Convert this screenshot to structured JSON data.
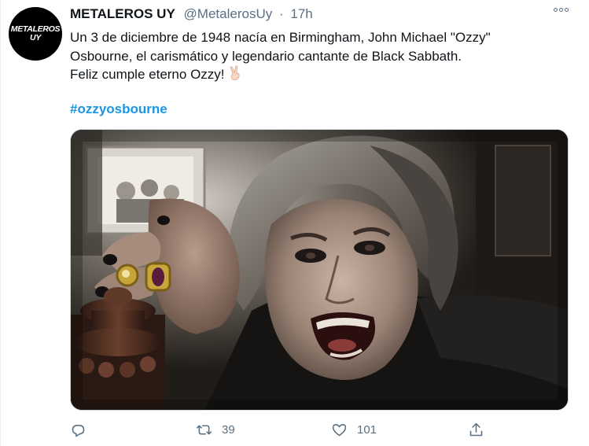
{
  "account": {
    "avatar_line1": "METALEROS",
    "avatar_line2": "UY",
    "display_name": "METALEROS UY",
    "handle": "@MetalerosUy",
    "separator": "·",
    "time": "17h"
  },
  "tweet": {
    "text_line1": "Un 3 de diciembre de 1948 nacía en Birmingham, John Michael \"Ozzy\"",
    "text_line2": "Osbourne, el carismático y legendario cantante de Black Sabbath.",
    "text_line3": "Feliz cumple eterno Ozzy!",
    "hashtag": "#ozzyosbourne",
    "emoji": "victory-hand"
  },
  "actions": {
    "reply_count": "",
    "retweet_count": "39",
    "like_count": "101"
  },
  "icons": {
    "more": "more-dots-icon",
    "reply": "reply-icon",
    "retweet": "retweet-icon",
    "like": "heart-icon",
    "share": "share-icon"
  },
  "colors": {
    "text_primary": "#0f1419",
    "text_secondary": "#5b7083",
    "link": "#1b95e0",
    "border": "#cfd9de"
  }
}
